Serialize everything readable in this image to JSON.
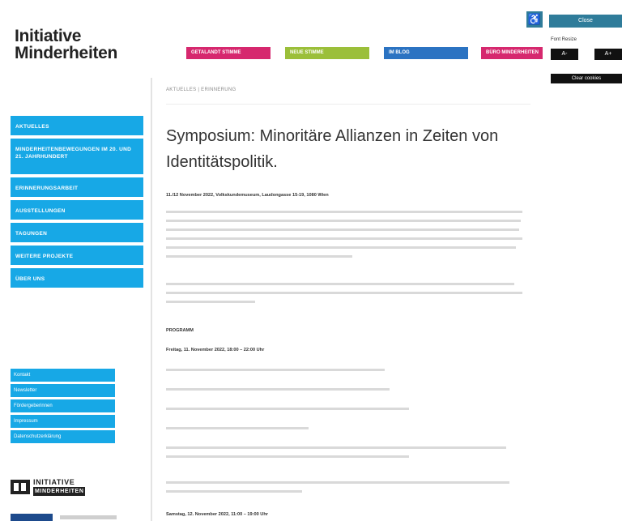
{
  "logo": {
    "line1": "Initiative",
    "line2": "Minderheiten"
  },
  "top_nav": [
    {
      "label": "GETALANDT STIMME",
      "color": "#d6286e"
    },
    {
      "label": "NEUE STIMME",
      "color": "#9bbf3a"
    },
    {
      "label": "IM BLOG",
      "color": "#2b73c2"
    },
    {
      "label": "BÜRO MINDERHEITEN",
      "color": "#d6286e"
    }
  ],
  "tools": {
    "close_label": "Close",
    "font_resize_label": "Font Resize",
    "decrease_label": "A-",
    "increase_label": "A+",
    "clear_label": "Clear cookies"
  },
  "sidebar": [
    {
      "label": "AKTUELLES"
    },
    {
      "label": "MINDERHEITENBEWEGUNGEN IM 20. UND 21. JAHRHUNDERT"
    },
    {
      "label": "ERINNERUNGSARBEIT"
    },
    {
      "label": "AUSSTELLUNGEN"
    },
    {
      "label": "TAGUNGEN"
    },
    {
      "label": "WEITERE PROJEKTE"
    },
    {
      "label": "ÜBER UNS"
    }
  ],
  "subnav": [
    {
      "label": "Kontakt"
    },
    {
      "label": "Newsletter"
    },
    {
      "label": "Fördergeberinnen"
    },
    {
      "label": "Impressum"
    },
    {
      "label": "Datenschutzerklärung"
    }
  ],
  "footer_logo": {
    "line1": "INITIATIVE",
    "line2": "MINDERHEITEN"
  },
  "content": {
    "breadcrumb": "AKTUELLES | ERINNERUNG",
    "title": "Symposium: Minoritäre Allianzen in Zeiten von Identitätspolitik.",
    "date_line": "11./12 November 2022, Volkskundemuseum, Laudongasse 15-19, 1080 Wien",
    "program_label": "PROGRAMM",
    "friday_label": "Freitag, 11. November 2022, 18:00 – 22:00 Uhr",
    "saturday_label": "Samstag, 12. November 2022, 11:00 – 19:00 Uhr"
  }
}
